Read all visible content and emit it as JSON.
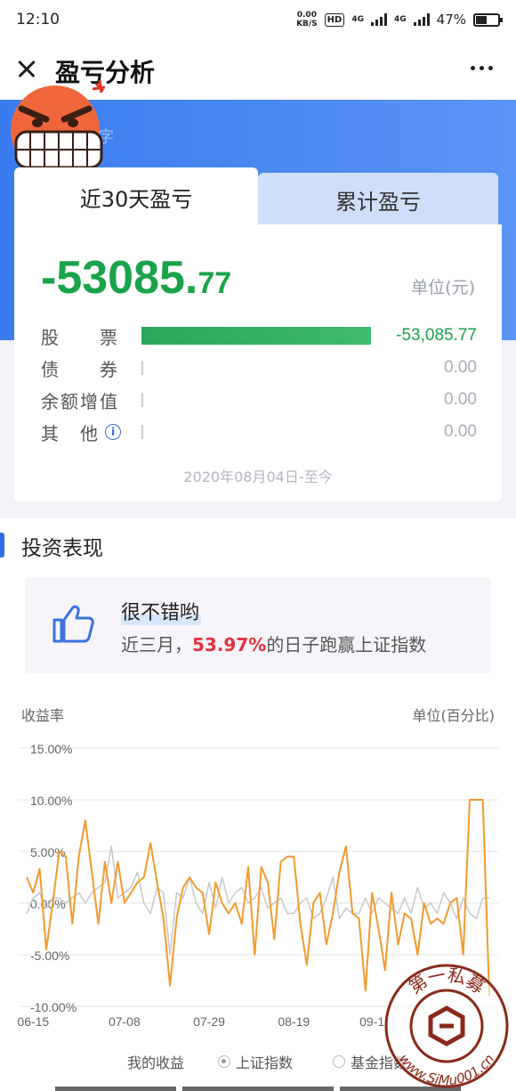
{
  "status_bar": {
    "time": "12:10",
    "net_speed_value": "0.00",
    "net_speed_unit": "KB/S",
    "hd_label": "HD",
    "network_1": "4G",
    "network_2": "4G",
    "battery_pct": "47%"
  },
  "nav": {
    "title": "盈亏分析"
  },
  "header_hint": "字",
  "tabs": {
    "active": "近30天盈亏",
    "inactive": "累计盈亏"
  },
  "summary": {
    "amount_int": "-53085.",
    "amount_dec": "77",
    "unit": "单位(元)",
    "rows": [
      {
        "label": "股　　票",
        "value": "-53,085.77",
        "fraction": 1.0,
        "negative": true
      },
      {
        "label": "债　　券",
        "value": "0.00",
        "fraction": 0.0,
        "negative": false
      },
      {
        "label": "余额增值",
        "value": "0.00",
        "fraction": 0.0,
        "negative": false
      },
      {
        "label": "其　他",
        "value": "0.00",
        "fraction": 0.0,
        "negative": false
      }
    ],
    "date_range": "2020年08月04日-至今"
  },
  "section": {
    "title": "投资表现"
  },
  "performance": {
    "headline": "很不错哟",
    "desc_prefix": "近三月，",
    "desc_pct": "53.97%",
    "desc_suffix": "的日子跑赢上证指数"
  },
  "chart_meta": {
    "ylabel": "收益率",
    "unit": "单位(百分比)"
  },
  "legend": {
    "mine": "我的收益",
    "index": "上证指数",
    "fund": "基金指数"
  },
  "watermark": {
    "top_text": "第一私募",
    "bottom_text": "www.SiMu001.cn"
  },
  "colors": {
    "brand_blue": "#3a7cf0",
    "gain_green": "#1aa34a",
    "highlight_red": "#e5323f",
    "my_series": "#f39a2d",
    "index_series": "#c8c8c8"
  },
  "chart_data": {
    "type": "line",
    "ylim": [
      -10,
      15
    ],
    "yticks": [
      15,
      10,
      5,
      0,
      -5,
      -10
    ],
    "ytick_labels": [
      "15.00%",
      "10.00%",
      "5.00%",
      "0.00%",
      "-5.00%",
      "-10.00%"
    ],
    "xtick_labels": [
      "06-15",
      "07-08",
      "07-29",
      "08-19",
      "09-1"
    ],
    "xtick_index": [
      1,
      15,
      28,
      41,
      53
    ],
    "series": [
      {
        "name": "我的收益",
        "values": [
          2.5,
          1.0,
          3.3,
          -4.5,
          0.0,
          5.0,
          4.5,
          -2.0,
          4.5,
          8.0,
          3.0,
          -2.0,
          4.0,
          0.0,
          4.0,
          0.0,
          1.0,
          2.0,
          2.5,
          5.8,
          2.0,
          -1.5,
          -8.0,
          -1.5,
          1.5,
          2.5,
          1.5,
          1.0,
          -3.0,
          2.0,
          0.0,
          -1.0,
          0.0,
          -2.0,
          3.5,
          -5.0,
          3.5,
          2.0,
          -3.5,
          4.0,
          4.5,
          4.5,
          -2.0,
          -6.0,
          0.0,
          1.0,
          -4.0,
          -1.0,
          3.0,
          5.5,
          -1.0,
          -1.5,
          -8.5,
          1.0,
          -2.5,
          -6.5,
          1.0,
          -4.0,
          -1.0,
          -1.5,
          -5.0,
          0.0,
          -2.0,
          -1.5,
          -2.0,
          0.0,
          0.5,
          -5.0,
          10.0,
          10.0,
          10.0,
          -9.0
        ],
        "color": "#f39a2d"
      },
      {
        "name": "上证指数",
        "values": [
          -1.0,
          0.5,
          1.0,
          -0.5,
          0.5,
          0.5,
          0.0,
          0.5,
          1.0,
          0.0,
          1.0,
          1.5,
          2.0,
          5.5,
          0.5,
          1.0,
          1.5,
          3.0,
          0.0,
          -1.0,
          1.5,
          1.0,
          -5.0,
          1.0,
          0.5,
          2.5,
          0.0,
          -1.0,
          2.0,
          -0.5,
          2.5,
          0.0,
          1.0,
          1.5,
          0.0,
          0.5,
          1.5,
          -0.5,
          0.0,
          0.5,
          -1.0,
          -1.0,
          0.0,
          0.5,
          -1.5,
          -1.0,
          0.5,
          2.5,
          -1.5,
          -0.5,
          -1.0,
          -1.0,
          0.5,
          -1.0,
          0.5,
          0.0,
          -0.5,
          -1.0,
          0.5,
          -1.0,
          1.5,
          -0.5,
          0.0,
          -1.0,
          1.0,
          0.0,
          -1.5,
          0.5,
          -1.0,
          -1.5,
          0.5,
          0.5
        ],
        "color": "#c8c8c8"
      }
    ]
  }
}
